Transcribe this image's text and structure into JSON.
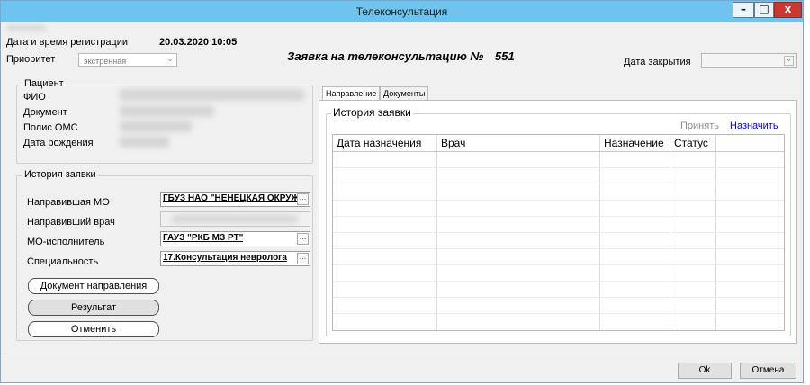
{
  "window": {
    "title": "Телеконсультация",
    "minimize": "–",
    "maximize": "□",
    "close": "x"
  },
  "header": {
    "reg_label": "Дата и время регистрации",
    "reg_value": "20.03.2020 10:05",
    "priority_label": "Приоритет",
    "priority_value": "экстренная",
    "request_title": "Заявка на телеконсультацию №",
    "request_number": "551",
    "close_date_label": "Дата закрытия"
  },
  "patient": {
    "title": "Пациент",
    "fio_label": "ФИО",
    "document_label": "Документ",
    "oms_label": "Полис ОМС",
    "birth_label": "Дата рождения"
  },
  "history_left": {
    "title": "История заявки",
    "sending_mo_label": "Направившая МО",
    "sending_mo_value": "ГБУЗ НАО \"НЕНЕЦКАЯ ОКРУЖ",
    "sending_doctor_label": "Направивший врач",
    "executor_label": "МО-исполнитель",
    "executor_value": "ГАУЗ \"РКБ МЗ РТ\"",
    "specialty_label": "Специальность",
    "specialty_value": "17.Консультация невролога",
    "btn_document": "Документ направления",
    "btn_result": "Результат",
    "btn_cancel": "Отменить"
  },
  "tabs": {
    "direction": "Направление",
    "documents": "Документы"
  },
  "history_right": {
    "title": "История заявки",
    "accept": "Принять",
    "assign": "Назначить",
    "columns": [
      "Дата назначения",
      "Врач",
      "Назначение",
      "Статус"
    ]
  },
  "footer": {
    "ok": "Ok",
    "cancel": "Отмена"
  },
  "colors": {
    "titlebar": "#6ec4ee",
    "close_button": "#c9392f",
    "link": "#0000ee"
  }
}
